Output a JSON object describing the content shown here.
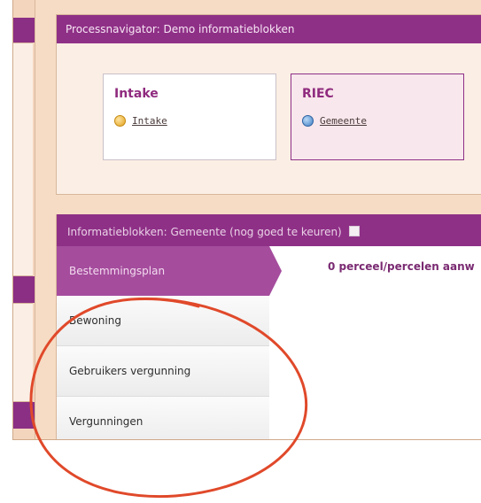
{
  "process_navigator": {
    "header": "Processnavigator: Demo informatieblokken",
    "cards": [
      {
        "title": "Intake",
        "item": "Intake",
        "status_color": "#e4a21d"
      },
      {
        "title": "RIEC",
        "item": "Gemeente",
        "status_color": "#3f7fc4"
      }
    ]
  },
  "info_blocks": {
    "header": "Informatieblokken: Gemeente (nog goed te keuren)",
    "sidebar": [
      {
        "label": "Bestemmingsplan"
      },
      {
        "label": "Bewoning"
      },
      {
        "label": "Gebruikers vergunning"
      },
      {
        "label": "Vergunningen"
      }
    ],
    "content_text": "0 perceel/percelen aanw"
  },
  "colors": {
    "accent": "#8f3087",
    "active_tab": "#a54c9d",
    "annotation": "#e0492a"
  }
}
